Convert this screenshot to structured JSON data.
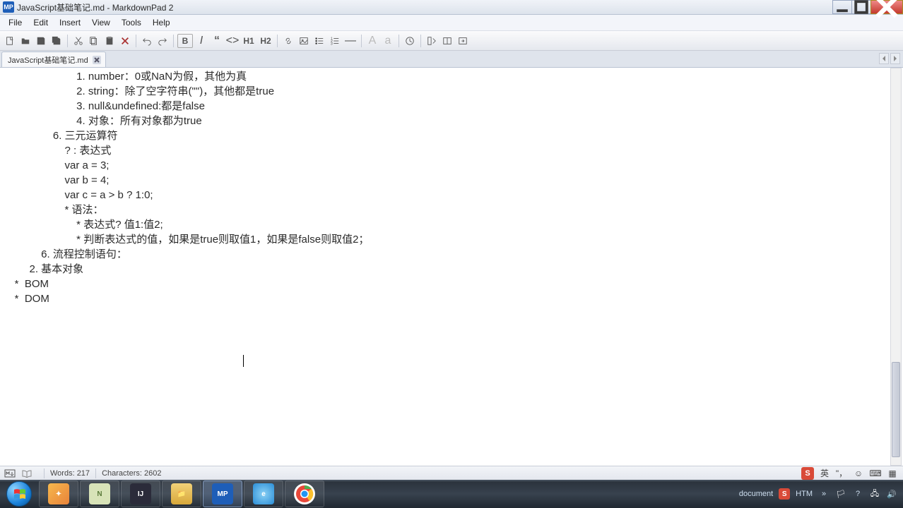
{
  "window": {
    "title": "JavaScript基础笔记.md - MarkdownPad 2",
    "app_icon": "MP"
  },
  "menus": [
    "File",
    "Edit",
    "Insert",
    "View",
    "Tools",
    "Help"
  ],
  "toolbar": {
    "h1": "H1",
    "h2": "H2",
    "bold": "B",
    "italic": "a"
  },
  "tab": {
    "name": "JavaScript基础笔记.md"
  },
  "editor": {
    "lines": [
      "                         1. number：0或NaN为假，其他为真",
      "                         2. string：除了空字符串(\"\")，其他都是true",
      "                         3. null&undefined:都是false",
      "                         4. 对象：所有对象都为true",
      "",
      "                 6. 三元运算符",
      "                     ? : 表达式",
      "                     var a = 3;",
      "                     var b = 4;",
      "",
      "                     var c = a > b ? 1:0;",
      "                     * 语法：",
      "                         * 表达式? 值1:值2;",
      "                         * 判断表达式的值，如果是true则取值1，如果是false则取值2；",
      "",
      "             6. 流程控制语句：",
      "         2. 基本对象",
      "",
      "    *  BOM",
      "",
      "    *  DOM"
    ]
  },
  "status": {
    "words": "Words: 217",
    "chars": "Characters: 2602",
    "lang": "英",
    "ime": "document",
    "htm": "HTM"
  },
  "taskbar": {
    "docs": "document"
  }
}
